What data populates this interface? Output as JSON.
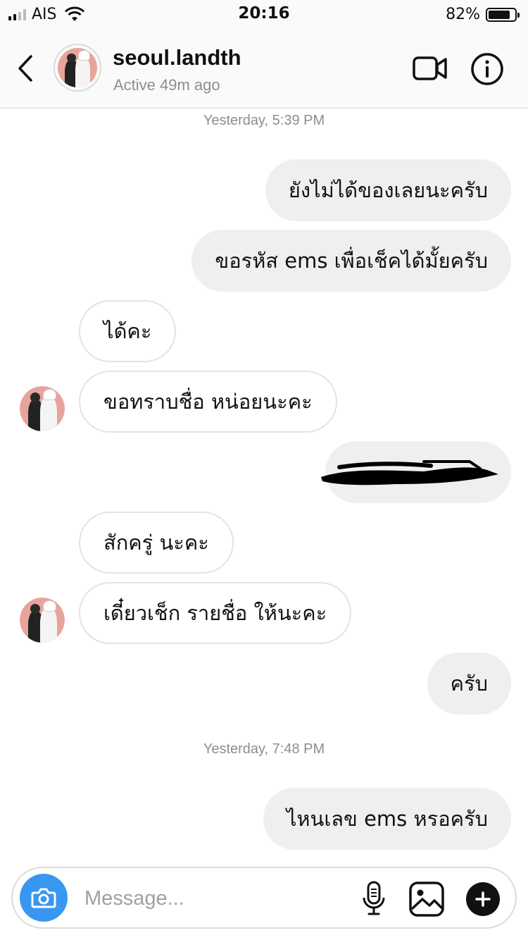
{
  "status_bar": {
    "carrier": "AIS",
    "time": "20:16",
    "battery_percent_label": "82%",
    "battery_level": 0.82
  },
  "header": {
    "username": "seoul.landth",
    "status": "Active 49m ago"
  },
  "conversation": {
    "timestamps": [
      "Yesterday, 5:39 PM",
      "Yesterday, 7:48 PM"
    ],
    "messages": [
      {
        "side": "sent",
        "text": "ยังไม่ได้ของเลยนะครับ"
      },
      {
        "side": "sent",
        "text": "ขอรหัส ems เพื่อเช็คได้มั้ยครับ"
      },
      {
        "side": "received",
        "text": "ได้คะ"
      },
      {
        "side": "received",
        "text": "ขอทราบชื่อ หน่อยนะคะ"
      },
      {
        "side": "sent",
        "text": "",
        "redacted": true
      },
      {
        "side": "received",
        "text": "สักครู่ นะคะ"
      },
      {
        "side": "received",
        "text": "เดี๋ยวเช็ก รายชื่อ ให้นะคะ"
      },
      {
        "side": "sent",
        "text": "ครับ"
      },
      {
        "side": "sent",
        "text": "ไหนเลข ems หรอครับ"
      }
    ]
  },
  "composer": {
    "placeholder": "Message..."
  },
  "icons": {
    "back": "chevron-left-icon",
    "video": "video-camera-icon",
    "info": "info-icon",
    "camera": "camera-icon",
    "mic": "microphone-icon",
    "gallery": "image-gallery-icon",
    "plus": "plus-icon"
  },
  "colors": {
    "accent": "#3897f0",
    "sent_bubble": "#efefef",
    "received_border": "#e3e3e3",
    "muted_text": "#8e8e8e"
  }
}
